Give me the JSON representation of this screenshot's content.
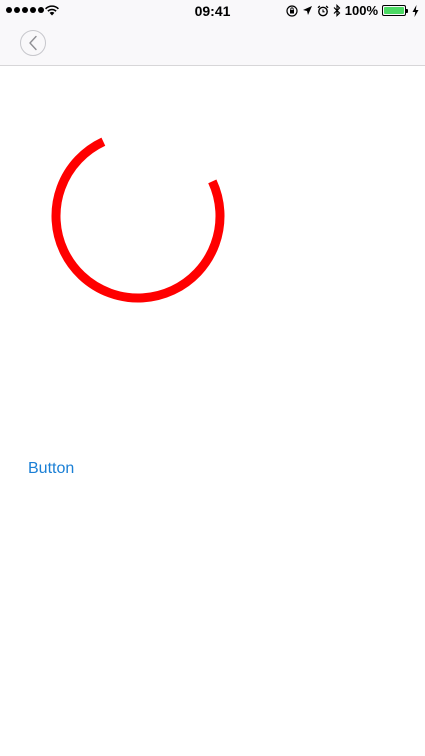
{
  "status_bar": {
    "time": "09:41",
    "battery_percent": "100%",
    "battery_level": 1.0,
    "signal_bars": 5,
    "icons": [
      "wifi-icon",
      "orientation-lock-icon",
      "location-arrow-icon",
      "alarm-icon",
      "bluetooth-icon",
      "charging-icon"
    ]
  },
  "nav_bar": {
    "back_icon": "chevron-left-icon"
  },
  "spinner": {
    "color": "#ff0000",
    "arc_start_deg": 205,
    "arc_sweep_deg": 270
  },
  "main": {
    "button_label": "Button"
  },
  "colors": {
    "accent": "#1a7fd5",
    "battery": "#4cd964",
    "bar_background": "#f9f8fa"
  }
}
